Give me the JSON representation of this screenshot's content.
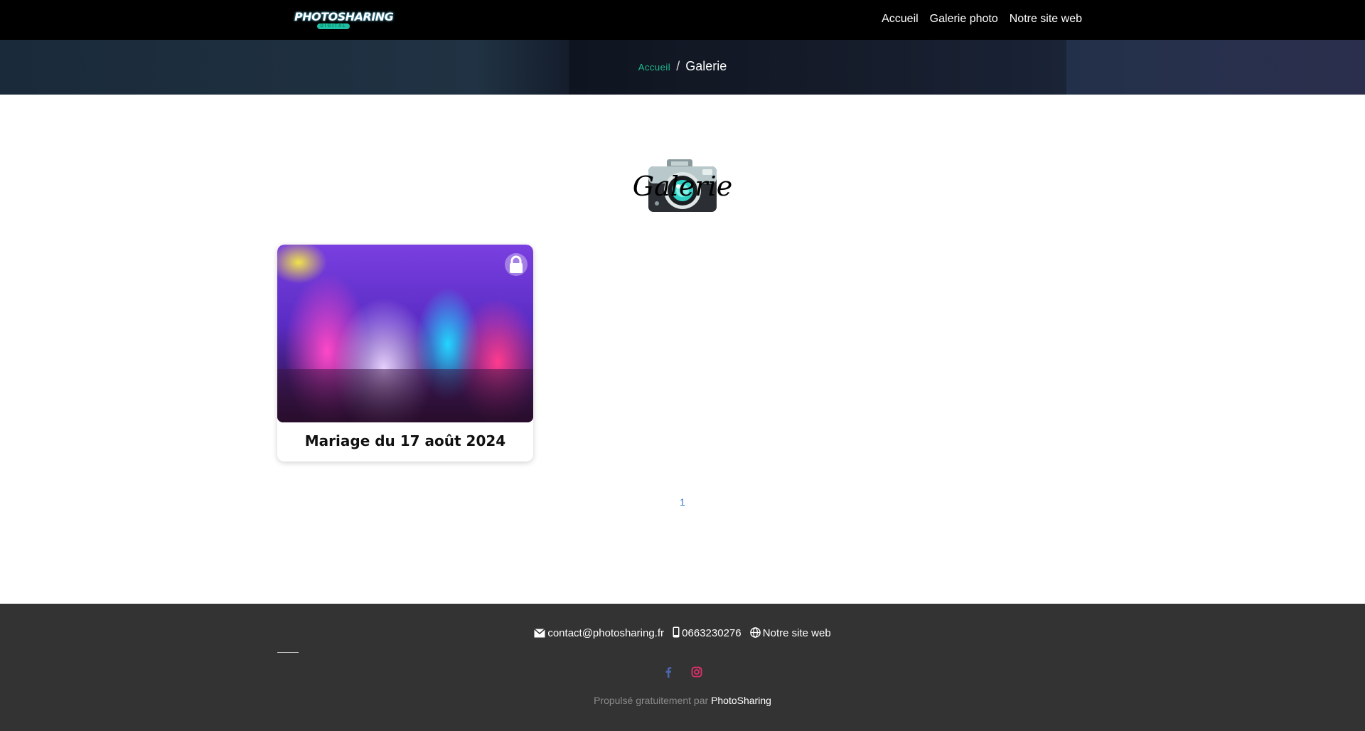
{
  "nav": {
    "logo_text": "PHOTOSHARING",
    "logo_sub": "DIGITAL",
    "links": [
      "Accueil",
      "Galerie photo",
      "Notre site web"
    ]
  },
  "breadcrumb": {
    "home": "Accueil",
    "separator": "/",
    "current": "Galerie"
  },
  "gallery": {
    "title": "Galerie",
    "icon": "camera-icon",
    "cards": [
      {
        "title": "Mariage du 17 août 2024",
        "locked": true,
        "lock_icon": "lock-icon"
      }
    ]
  },
  "pagination": {
    "current_page": "1"
  },
  "footer": {
    "email": "contact@photosharing.fr",
    "phone": "0663230276",
    "website": "Notre site web",
    "social": [
      "facebook-icon",
      "instagram-icon"
    ],
    "credit_prefix": "Propulsé gratuitement par",
    "credit_brand": "PhotoSharing"
  },
  "colors": {
    "nav_bg": "#000000",
    "accent": "#1fbf8f",
    "footer_bg": "#333333",
    "pagination": "#3a7bd5",
    "facebook": "#4a67ad",
    "instagram": "#e1306c"
  }
}
